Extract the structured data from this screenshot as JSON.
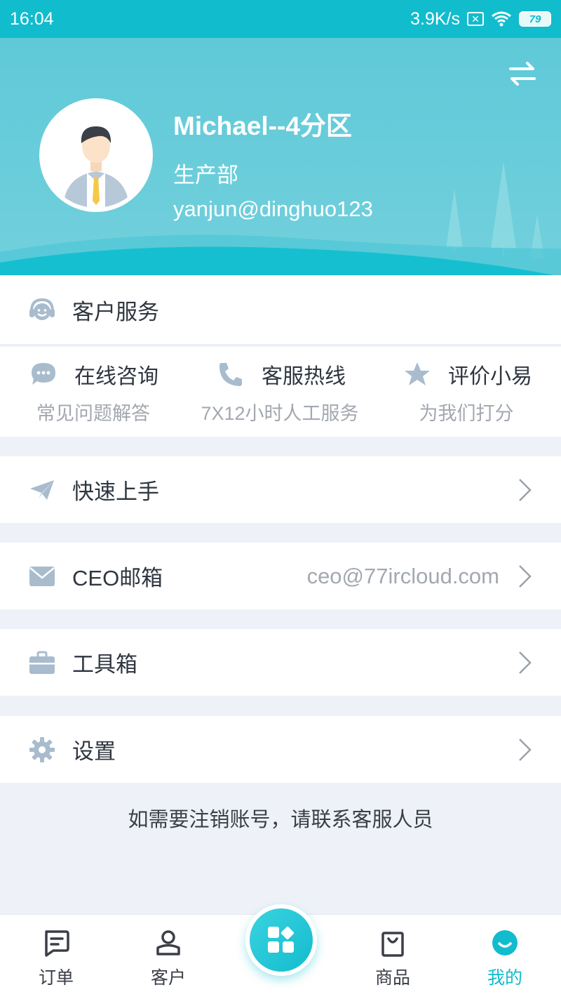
{
  "status_bar": {
    "time": "16:04",
    "speed": "3.9K/s",
    "battery": "79"
  },
  "profile": {
    "name": "Michael--4分区",
    "department": "生产部",
    "email": "yanjun@dinghuo123"
  },
  "customer_service": {
    "label": "客户服务"
  },
  "support": [
    {
      "title": "在线咨询",
      "subtitle": "常见问题解答"
    },
    {
      "title": "客服热线",
      "subtitle": "7X12小时人工服务"
    },
    {
      "title": "评价小易",
      "subtitle": "为我们打分"
    }
  ],
  "menu": {
    "quick_start": {
      "label": "快速上手"
    },
    "ceo_mail": {
      "label": "CEO邮箱",
      "value": "ceo@77ircloud.com"
    },
    "toolbox": {
      "label": "工具箱"
    },
    "settings": {
      "label": "设置"
    }
  },
  "note": "如需要注销账号，请联系客服人员",
  "nav": [
    {
      "label": "订单"
    },
    {
      "label": "客户"
    },
    {
      "label": "商品"
    },
    {
      "label": "我的"
    }
  ],
  "colors": {
    "accent": "#11bccd",
    "header": "#6ccfdb",
    "icon_gray": "#a9bccd"
  }
}
